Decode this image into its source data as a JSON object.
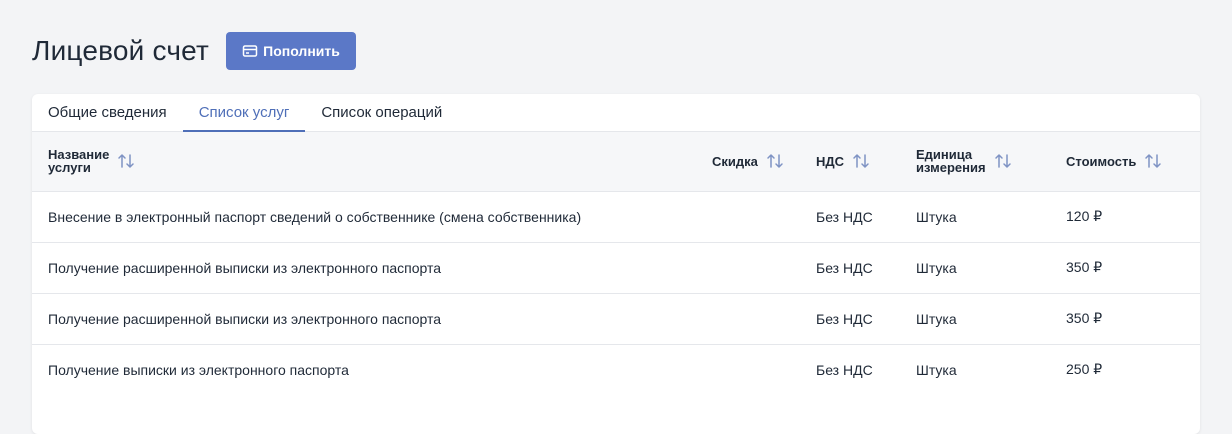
{
  "header": {
    "title": "Лицевой счет",
    "topup_label": "Пополнить"
  },
  "tabs": [
    {
      "label": "Общие сведения",
      "active": false
    },
    {
      "label": "Список услуг",
      "active": true
    },
    {
      "label": "Список операций",
      "active": false
    }
  ],
  "table": {
    "columns": {
      "name_line1": "Название",
      "name_line2": "услуги",
      "discount": "Скидка",
      "vat": "НДС",
      "unit_line1": "Единица",
      "unit_line2": "измерения",
      "cost": "Стоимость"
    },
    "rows": [
      {
        "name": "Внесение в электронный паспорт сведений о собственнике (смена собственника)",
        "discount": "",
        "vat": "Без НДС",
        "unit": "Штука",
        "cost": "120 ₽"
      },
      {
        "name": "Получение расширенной выписки из электронного паспорта",
        "discount": "",
        "vat": "Без НДС",
        "unit": "Штука",
        "cost": "350 ₽"
      },
      {
        "name": "Получение расширенной выписки из электронного паспорта",
        "discount": "",
        "vat": "Без НДС",
        "unit": "Штука",
        "cost": "350 ₽"
      },
      {
        "name": "Получение выписки из электронного паспорта",
        "discount": "",
        "vat": "Без НДС",
        "unit": "Штука",
        "cost": "250 ₽"
      }
    ]
  },
  "icons": {
    "topup": "credit-card-icon",
    "sort": "sort-arrows-icon"
  },
  "colors": {
    "accent": "#5b78c7",
    "active_tab": "#4f6fb8"
  }
}
